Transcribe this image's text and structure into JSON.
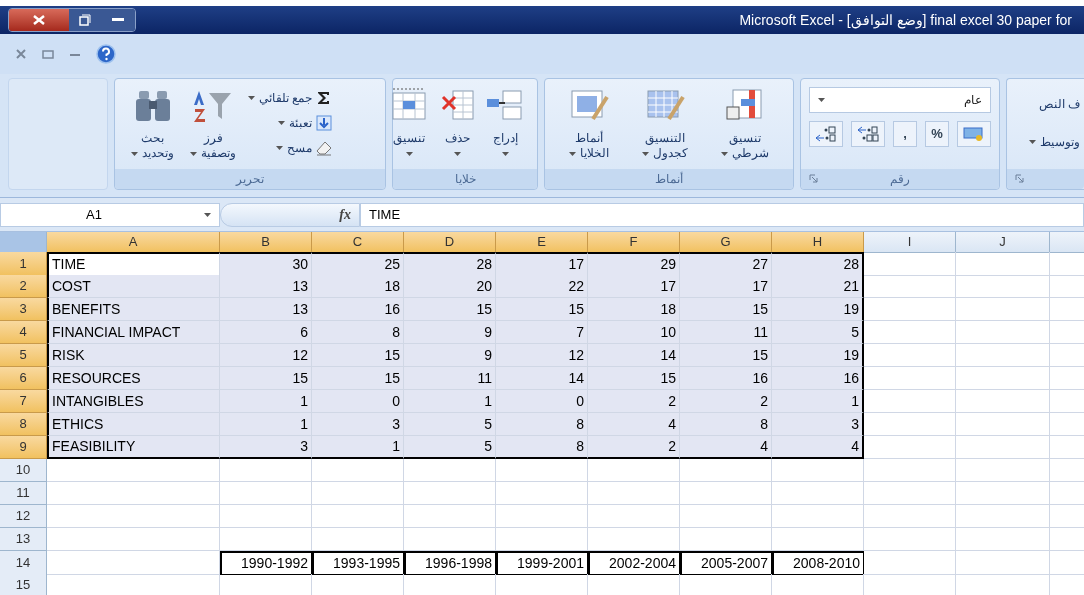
{
  "window": {
    "title": "Microsoft Excel - [وضع التوافق]  final excel 30 paper for"
  },
  "ribbon": {
    "groups": [
      {
        "kind": "alignment",
        "lines": [
          "ف النص",
          "وتوسيط"
        ]
      },
      {
        "kind": "number",
        "label": "رقم",
        "format": "عام",
        "buttons": [
          {
            "kind": "currency"
          },
          {
            "kind": "symbol",
            "symbol": "%"
          },
          {
            "kind": "symbol",
            "symbol": ","
          },
          {
            "kind": "increase-decimal"
          },
          {
            "kind": "decrease-decimal"
          }
        ]
      },
      {
        "kind": "styles",
        "label": "أنماط",
        "large": [
          {
            "kind": "conditional",
            "lines": [
              "تنسيق",
              "شرطي"
            ]
          },
          {
            "kind": "table",
            "lines": [
              "التنسيق",
              "كجدول"
            ]
          },
          {
            "kind": "cell-styles",
            "lines": [
              "أنماط",
              "الخلايا"
            ]
          }
        ]
      },
      {
        "kind": "cells",
        "label": "خلايا",
        "large": [
          {
            "kind": "insert",
            "lines": [
              "إدراج"
            ]
          },
          {
            "kind": "delete",
            "lines": [
              "حذف"
            ]
          },
          {
            "kind": "format",
            "lines": [
              "تنسيق"
            ]
          }
        ]
      },
      {
        "kind": "editing",
        "label": "تحرير",
        "small": [
          {
            "kind": "autosum",
            "label": "جمع تلقائي"
          },
          {
            "kind": "fill",
            "label": "تعبئة"
          },
          {
            "kind": "clear",
            "label": "مسح"
          }
        ],
        "large": [
          {
            "kind": "sort",
            "lines": [
              "فرز",
              "وتصفية"
            ]
          },
          {
            "kind": "find",
            "lines": [
              "بحث",
              "وتحديد"
            ]
          }
        ]
      }
    ]
  },
  "formula_bar": {
    "name_box": "A1",
    "function_label": "fx",
    "value": "TIME"
  },
  "sheet": {
    "columns": {
      "a": {
        "label": "A",
        "selected": true
      },
      "b": {
        "label": "B",
        "selected": true
      },
      "c": {
        "label": "C",
        "selected": true
      },
      "d": {
        "label": "D",
        "selected": true
      },
      "e": {
        "label": "E",
        "selected": true
      },
      "f": {
        "label": "F",
        "selected": true
      },
      "g": {
        "label": "G",
        "selected": true
      },
      "h": {
        "label": "H",
        "selected": true
      },
      "i": {
        "label": "I",
        "selected": false
      },
      "j": {
        "label": "J",
        "selected": false
      }
    },
    "rows": [
      {
        "number": "1",
        "selected": true,
        "kind": "data",
        "cells": {
          "a": "TIME",
          "b": "30",
          "c": "25",
          "d": "28",
          "e": "17",
          "f": "29",
          "g": "27",
          "h": "28"
        }
      },
      {
        "number": "2",
        "selected": true,
        "kind": "data",
        "cells": {
          "a": "COST",
          "b": "13",
          "c": "18",
          "d": "20",
          "e": "22",
          "f": "17",
          "g": "17",
          "h": "21"
        }
      },
      {
        "number": "3",
        "selected": true,
        "kind": "data",
        "cells": {
          "a": "BENEFITS",
          "b": "13",
          "c": "16",
          "d": "15",
          "e": "15",
          "f": "18",
          "g": "15",
          "h": "19"
        }
      },
      {
        "number": "4",
        "selected": true,
        "kind": "data",
        "cells": {
          "a": "FINANCIAL IMPACT",
          "b": "6",
          "c": "8",
          "d": "9",
          "e": "7",
          "f": "10",
          "g": "11",
          "h": "5"
        }
      },
      {
        "number": "5",
        "selected": true,
        "kind": "data",
        "cells": {
          "a": "RISK",
          "b": "12",
          "c": "15",
          "d": "9",
          "e": "12",
          "f": "14",
          "g": "15",
          "h": "19"
        }
      },
      {
        "number": "6",
        "selected": true,
        "kind": "data",
        "cells": {
          "a": "RESOURCES",
          "b": "15",
          "c": "15",
          "d": "11",
          "e": "14",
          "f": "15",
          "g": "16",
          "h": "16"
        }
      },
      {
        "number": "7",
        "selected": true,
        "kind": "data",
        "cells": {
          "a": "INTANGIBLES",
          "b": "1",
          "c": "0",
          "d": "1",
          "e": "0",
          "f": "2",
          "g": "2",
          "h": "1"
        }
      },
      {
        "number": "8",
        "selected": true,
        "kind": "data",
        "cells": {
          "a": "ETHICS",
          "b": "1",
          "c": "3",
          "d": "5",
          "e": "8",
          "f": "4",
          "g": "8",
          "h": "3"
        }
      },
      {
        "number": "9",
        "selected": true,
        "kind": "data",
        "cells": {
          "a": "FEASIBILITY",
          "b": "3",
          "c": "1",
          "d": "5",
          "e": "8",
          "f": "2",
          "g": "4",
          "h": "4"
        }
      },
      {
        "number": "10",
        "selected": false,
        "kind": "empty"
      },
      {
        "number": "11",
        "selected": false,
        "kind": "empty"
      },
      {
        "number": "12",
        "selected": false,
        "kind": "empty"
      },
      {
        "number": "13",
        "selected": false,
        "kind": "empty"
      },
      {
        "number": "14",
        "selected": false,
        "kind": "periods",
        "cells": {
          "b": "1990-1992",
          "c": "1993-1995",
          "d": "1996-1998",
          "e": "1999-2001",
          "f": "2002-2004",
          "g": "2005-2007",
          "h": "2008-2010"
        }
      },
      {
        "number": "15",
        "selected": false,
        "kind": "empty"
      }
    ]
  }
}
